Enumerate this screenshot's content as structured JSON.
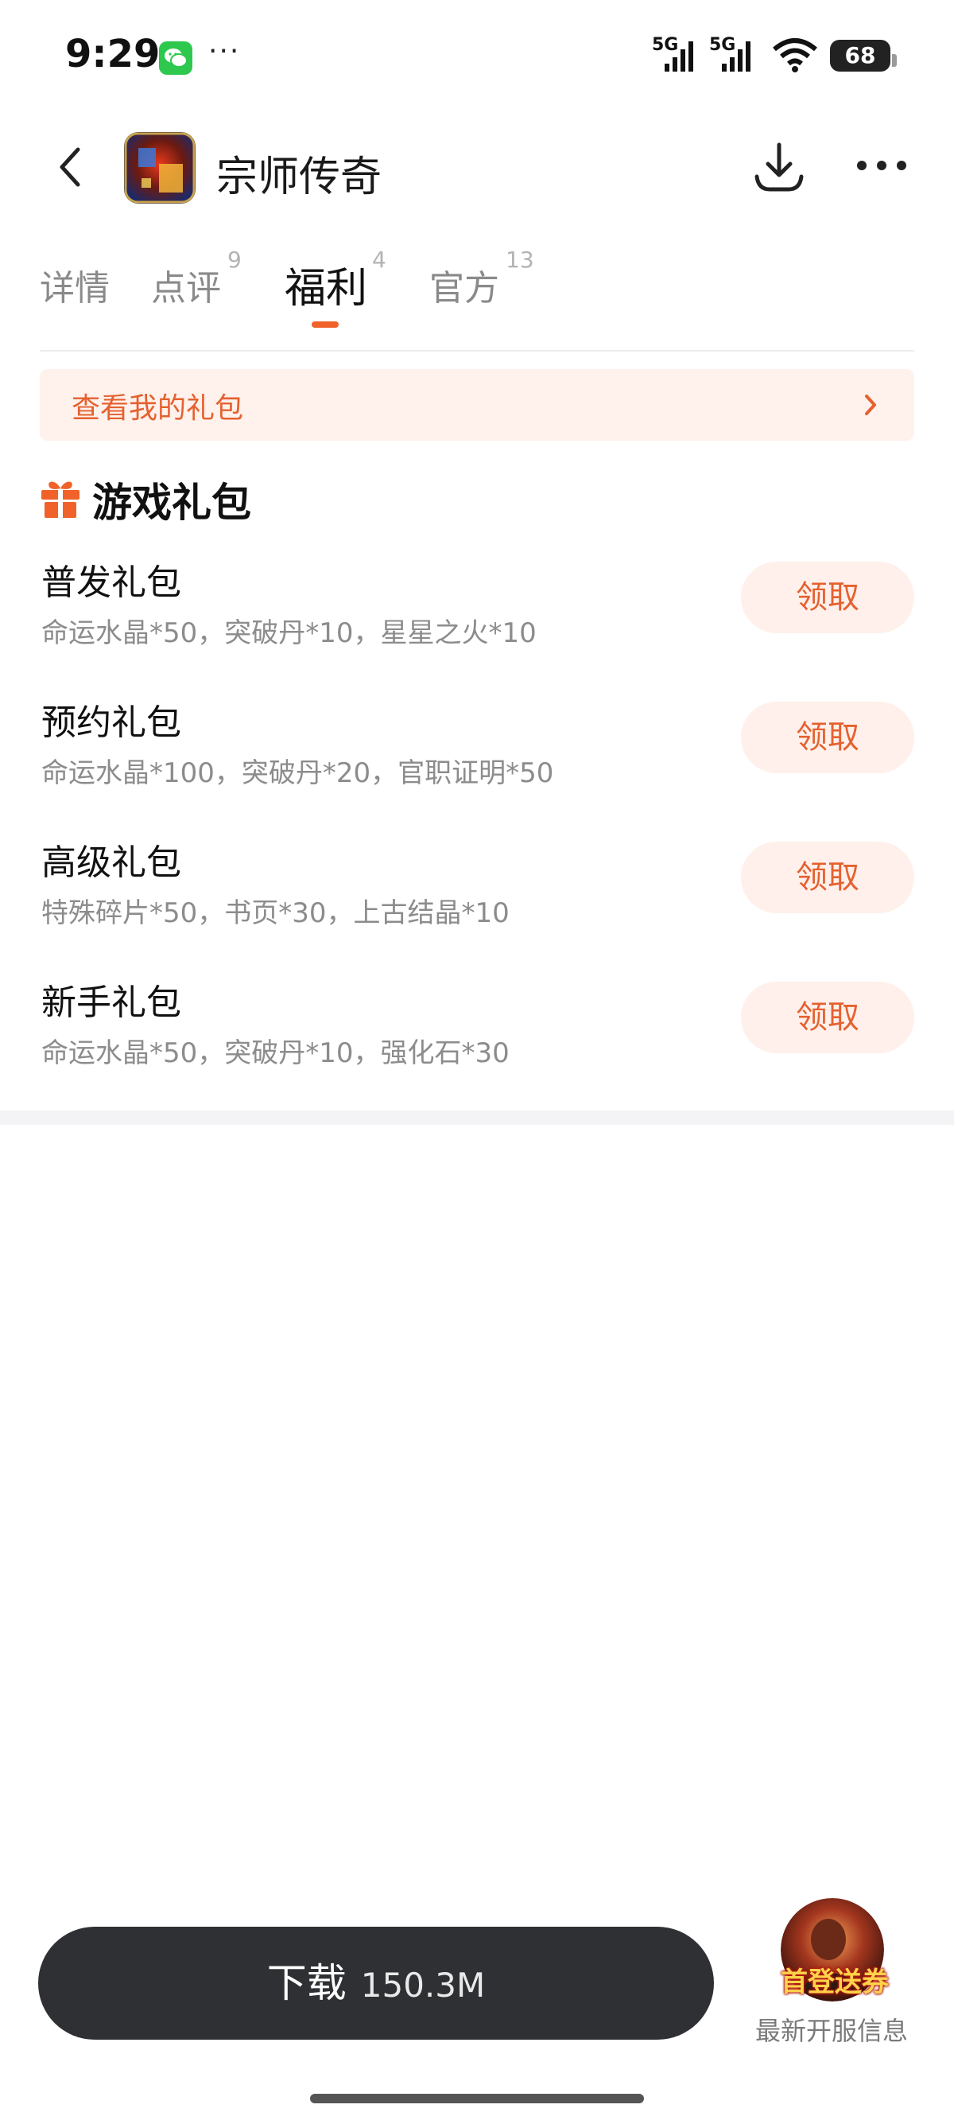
{
  "status_bar": {
    "time": "9:29",
    "more": "···",
    "signal_1": "5G",
    "signal_2": "5G",
    "battery": "68",
    "icons": [
      "wechat-icon",
      "signal-icon",
      "wifi-icon",
      "battery-icon"
    ]
  },
  "header": {
    "app_name": "宗师传奇",
    "icons": [
      "back-icon",
      "download-icon",
      "more-icon"
    ]
  },
  "tabs": [
    {
      "label": "详情",
      "count": ""
    },
    {
      "label": "点评",
      "count": "9"
    },
    {
      "label": "福利",
      "count": "4"
    },
    {
      "label": "官方",
      "count": "13"
    }
  ],
  "active_tab": "福利",
  "my_gifts": {
    "label": "查看我的礼包"
  },
  "section": {
    "title": "游戏礼包"
  },
  "gifts": [
    {
      "name": "普发礼包",
      "desc": "命运水晶*50，突破丹*10，星星之火*10",
      "button": "领取"
    },
    {
      "name": "预约礼包",
      "desc": "命运水晶*100，突破丹*20，官职证明*50",
      "button": "领取"
    },
    {
      "name": "高级礼包",
      "desc": "特殊碎片*50，书页*30，上古结晶*10",
      "button": "领取"
    },
    {
      "name": "新手礼包",
      "desc": "命运水晶*50，突破丹*10，强化石*30",
      "button": "领取"
    }
  ],
  "bottom_bar": {
    "download_label": "下载",
    "download_size": "150.3M",
    "server_badge": "首登送券",
    "server_label": "最新开服信息"
  },
  "colors": {
    "accent": "#e5612f",
    "accent_bg": "#fff0eb",
    "download_bar": "#2f3033"
  }
}
